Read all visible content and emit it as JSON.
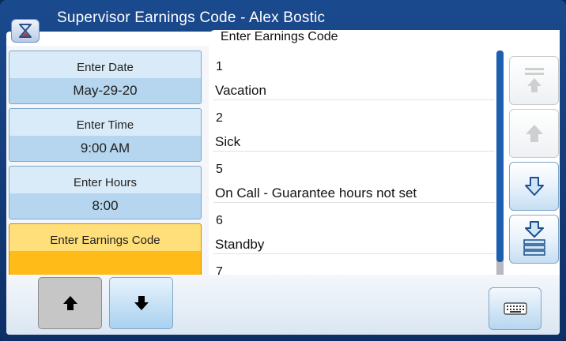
{
  "window": {
    "title": "Supervisor Earnings Code - Alex Bostic",
    "app_icon": "hourglass-icon"
  },
  "panel": {
    "title": "Enter Earnings Code"
  },
  "fields": [
    {
      "label": "Enter Date",
      "value": "May-29-20",
      "state": "filled"
    },
    {
      "label": "Enter Time",
      "value": "9:00 AM",
      "state": "filled"
    },
    {
      "label": "Enter Hours",
      "value": "8:00",
      "state": "filled"
    },
    {
      "label": "Enter Earnings Code",
      "value": "",
      "state": "active"
    }
  ],
  "codes": [
    {
      "code": "1",
      "description": "Vacation"
    },
    {
      "code": "2",
      "description": "Sick"
    },
    {
      "code": "5",
      "description": "On Call - Guarantee hours not set"
    },
    {
      "code": "6",
      "description": "Standby"
    },
    {
      "code": "7",
      "description": ""
    }
  ],
  "nav_buttons": [
    {
      "icon": "scroll-top-icon",
      "enabled": false
    },
    {
      "icon": "scroll-up-icon",
      "enabled": false
    },
    {
      "icon": "scroll-down-icon",
      "enabled": true
    },
    {
      "icon": "scroll-bottom-icon",
      "enabled": true
    }
  ],
  "field_nav": [
    {
      "icon": "field-up-icon",
      "state": "pressed"
    },
    {
      "icon": "field-down-icon",
      "state": "normal"
    }
  ],
  "keyboard_button": {
    "icon": "keyboard-icon"
  },
  "colors": {
    "accent": "#1d5fb0",
    "active_field": "#ffbb18",
    "title_bar": "#0d2f66"
  }
}
